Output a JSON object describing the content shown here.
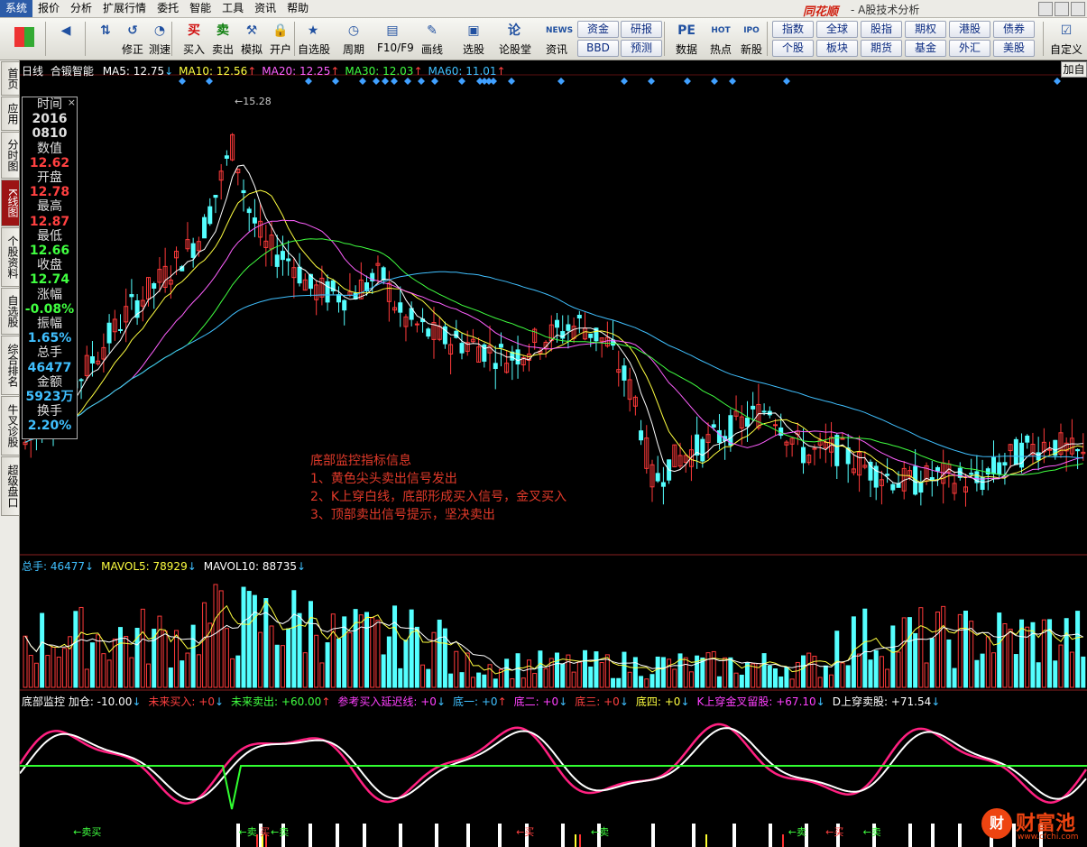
{
  "menu": [
    "系统",
    "报价",
    "分析",
    "扩展行情",
    "委托",
    "智能",
    "工具",
    "资讯",
    "帮助"
  ],
  "app": {
    "logo": "同花顺",
    "title": "- A股技术分析"
  },
  "toolbar": {
    "buttons": [
      {
        "name": "back-button",
        "label": "",
        "icon": "◀"
      },
      {
        "name": "updown-button",
        "label": "",
        "icon": "⇅"
      },
      {
        "name": "correct-button",
        "label": "修正",
        "icon": "↺"
      },
      {
        "name": "speed-test-button",
        "label": "测速",
        "icon": "◔"
      },
      {
        "name": "buy-button",
        "label": "买入",
        "icon": "买"
      },
      {
        "name": "sell-button",
        "label": "卖出",
        "icon": "卖"
      },
      {
        "name": "simulate-button",
        "label": "模拟",
        "icon": "⚒"
      },
      {
        "name": "open-account-button",
        "label": "开户",
        "icon": "🔒"
      },
      {
        "name": "watchlist-button",
        "label": "自选股",
        "icon": "★"
      },
      {
        "name": "period-button",
        "label": "周期",
        "icon": "◷"
      },
      {
        "name": "f10-button",
        "label": "F10/F9",
        "icon": "▤"
      },
      {
        "name": "draw-line-button",
        "label": "画线",
        "icon": "✎"
      },
      {
        "name": "stock-select-button",
        "label": "选股",
        "icon": "▣"
      },
      {
        "name": "forum-button",
        "label": "论股堂",
        "icon": "论"
      },
      {
        "name": "news-button",
        "label": "资讯",
        "icon": "NEWS"
      },
      {
        "name": "data-button",
        "label": "数据",
        "icon": "PE"
      },
      {
        "name": "hot-button",
        "label": "热点",
        "icon": "HOT"
      },
      {
        "name": "ipo-button",
        "label": "新股",
        "icon": "IPO"
      },
      {
        "name": "customize-button",
        "label": "自定义",
        "icon": "☑"
      }
    ],
    "grid1": [
      "资金",
      "研报",
      "BBD",
      "预测"
    ],
    "grid2": [
      "指数",
      "全球",
      "股指",
      "期权",
      "港股",
      "债券",
      "个股",
      "板块",
      "期货",
      "基金",
      "外汇",
      "美股"
    ]
  },
  "left_tabs": [
    "首页",
    "应用",
    "分时图",
    "K线图",
    "个股资料",
    "自选股",
    "综合排名",
    "牛叉诊股",
    "超级盘口"
  ],
  "legend": {
    "period": "日线",
    "stock": "合锻智能",
    "ma": [
      {
        "label": "MA5: 12.75",
        "arrow": "↓",
        "color": "#ffffff"
      },
      {
        "label": "MA10: 12.56",
        "arrow": "↑",
        "color": "#ffff40"
      },
      {
        "label": "MA20: 12.25",
        "arrow": "↑",
        "color": "#ff60ff"
      },
      {
        "label": "MA30: 12.03",
        "arrow": "↑",
        "color": "#40ff40"
      },
      {
        "label": "MA60: 11.01",
        "arrow": "↑",
        "color": "#40c0ff"
      }
    ]
  },
  "right_button": "加自",
  "info_panel": [
    {
      "label": "时间",
      "value": "2016\n0810",
      "color": "#e0e0e0"
    },
    {
      "label": "数值",
      "value": "12.62",
      "color": "#ff4040"
    },
    {
      "label": "开盘",
      "value": "12.78",
      "color": "#ff4040"
    },
    {
      "label": "最高",
      "value": "12.87",
      "color": "#ff4040"
    },
    {
      "label": "最低",
      "value": "12.66",
      "color": "#40ff40"
    },
    {
      "label": "收盘",
      "value": "12.74",
      "color": "#40ff40"
    },
    {
      "label": "涨幅",
      "value": "-0.08%",
      "color": "#40ff40"
    },
    {
      "label": "振幅",
      "value": "1.65%",
      "color": "#40c0ff"
    },
    {
      "label": "总手",
      "value": "46477",
      "color": "#40c0ff"
    },
    {
      "label": "金额",
      "value": "5923万",
      "color": "#40c0ff"
    },
    {
      "label": "换手",
      "value": "2.20%",
      "color": "#40c0ff"
    }
  ],
  "high_price_label": "←15.28",
  "note": [
    "底部监控指标信息",
    "1、黄色尖头卖出信号发出",
    "2、K上穿白线，底部形成买入信号，金叉买入",
    "3、顶部卖出信号提示，坚决卖出"
  ],
  "volume_legend": [
    {
      "label": "总手: 46477",
      "arrow": "↓",
      "color": "#40c0ff"
    },
    {
      "label": "MAVOL5: 78929",
      "arrow": "↓",
      "color": "#ffff40"
    },
    {
      "label": "MAVOL10: 88735",
      "arrow": "↓",
      "color": "#ffffff"
    }
  ],
  "indicator_legend": [
    {
      "label": "底部监控 加仓: -10.00",
      "arrow": "↓",
      "color": "#ffffff"
    },
    {
      "label": "未来买入: +0",
      "arrow": "↓",
      "color": "#ff4040"
    },
    {
      "label": "未来卖出: +60.00",
      "arrow": "↑",
      "color": "#40ff40"
    },
    {
      "label": "参考买入延迟线: +0",
      "arrow": "↓",
      "color": "#ff40ff"
    },
    {
      "label": "底一: +0",
      "arrow": "↑",
      "color": "#40c0ff"
    },
    {
      "label": "底二: +0",
      "arrow": "↓",
      "color": "#ff40ff"
    },
    {
      "label": "底三: +0",
      "arrow": "↓",
      "color": "#ff4040"
    },
    {
      "label": "底四: +0",
      "arrow": "↓",
      "color": "#ffff40"
    },
    {
      "label": "K上穿金叉留股: +67.10",
      "arrow": "↓",
      "color": "#ff40ff"
    },
    {
      "label": "D上穿卖股: +71.54",
      "arrow": "↓",
      "color": "#ffffff"
    }
  ],
  "signals": [
    {
      "text": "←卖买",
      "color": "#40ff40",
      "pos": 0.05
    },
    {
      "text": "←卖",
      "color": "#40ff40",
      "pos": 0.205
    },
    {
      "text": "买",
      "color": "#ff4040",
      "pos": 0.225
    },
    {
      "text": "←卖",
      "color": "#40ff40",
      "pos": 0.235
    },
    {
      "text": "←买",
      "color": "#ff4040",
      "pos": 0.465
    },
    {
      "text": "←卖",
      "color": "#40ff40",
      "pos": 0.535
    },
    {
      "text": "←卖",
      "color": "#40ff40",
      "pos": 0.72
    },
    {
      "text": "←买",
      "color": "#ff4040",
      "pos": 0.755
    },
    {
      "text": "←卖",
      "color": "#40ff40",
      "pos": 0.79
    }
  ],
  "watermark": {
    "text": "财富池",
    "badge": "财",
    "url": "www.cfchi.com"
  },
  "colors": {
    "up": "#ff3a3a",
    "down": "#54ffff",
    "ma5": "#ffffff",
    "ma10": "#ffff40",
    "ma20": "#ff60ff",
    "ma30": "#40ff40",
    "ma60": "#40c0ff",
    "diamond": "#40a0ff"
  }
}
